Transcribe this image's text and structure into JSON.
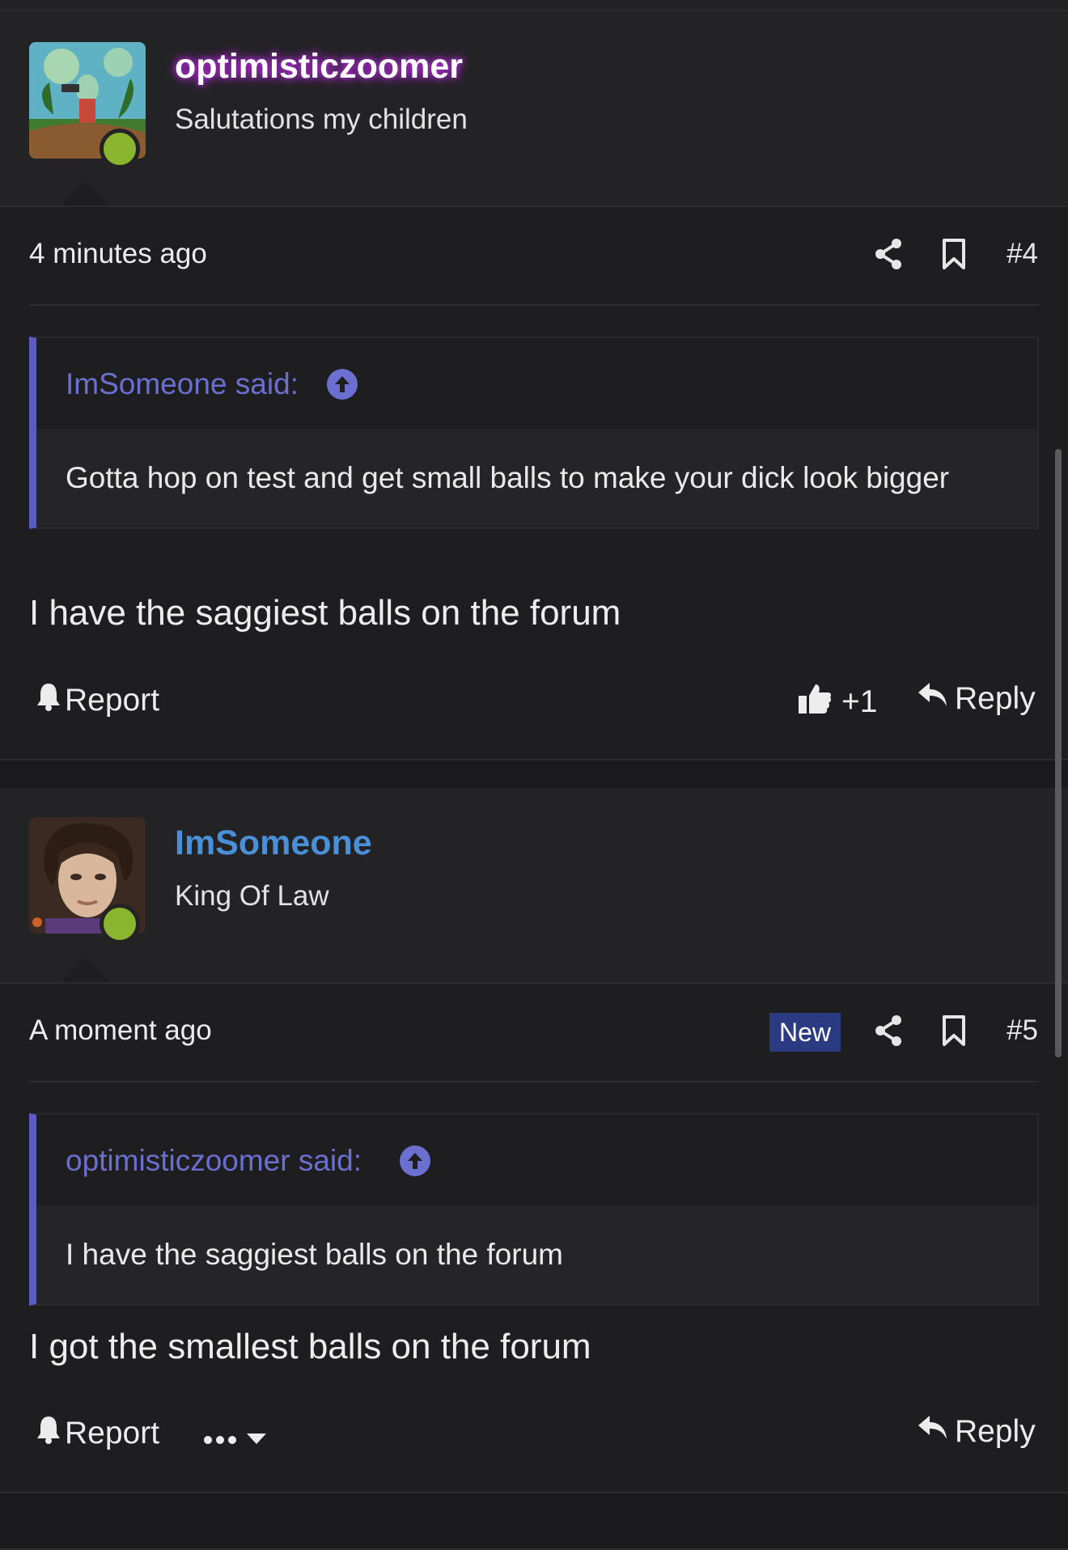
{
  "posts": [
    {
      "username": "optimisticzoomer",
      "user_title": "Salutations my children",
      "username_color": "#ffffff",
      "time": "4 minutes ago",
      "post_number": "#4",
      "quote": {
        "author": "ImSomeone said:",
        "text": "Gotta hop on test and get small balls to make your dick look bigger"
      },
      "message": "I have the saggiest balls on the forum",
      "report_label": "Report",
      "reaction_count": "+1",
      "reply_label": "Reply"
    },
    {
      "username": "ImSomeone",
      "user_title": "King Of Law",
      "username_color": "#4a90d9",
      "time": "A moment ago",
      "new_badge": "New",
      "post_number": "#5",
      "quote": {
        "author": "optimisticzoomer said:",
        "text": "I have the saggiest balls on the forum"
      },
      "message": "I got the smallest balls on the forum",
      "report_label": "Report",
      "reply_label": "Reply"
    }
  ],
  "colors": {
    "accent_quote": "#5c5cc0",
    "online": "#8ab52e",
    "new_badge_bg": "#2a3b82"
  },
  "icons": [
    "share-icon",
    "bookmark-icon",
    "bell-icon",
    "thumbs-up-icon",
    "reply-icon",
    "arrow-up-circle-icon",
    "more-options-icon",
    "caret-down-icon"
  ]
}
